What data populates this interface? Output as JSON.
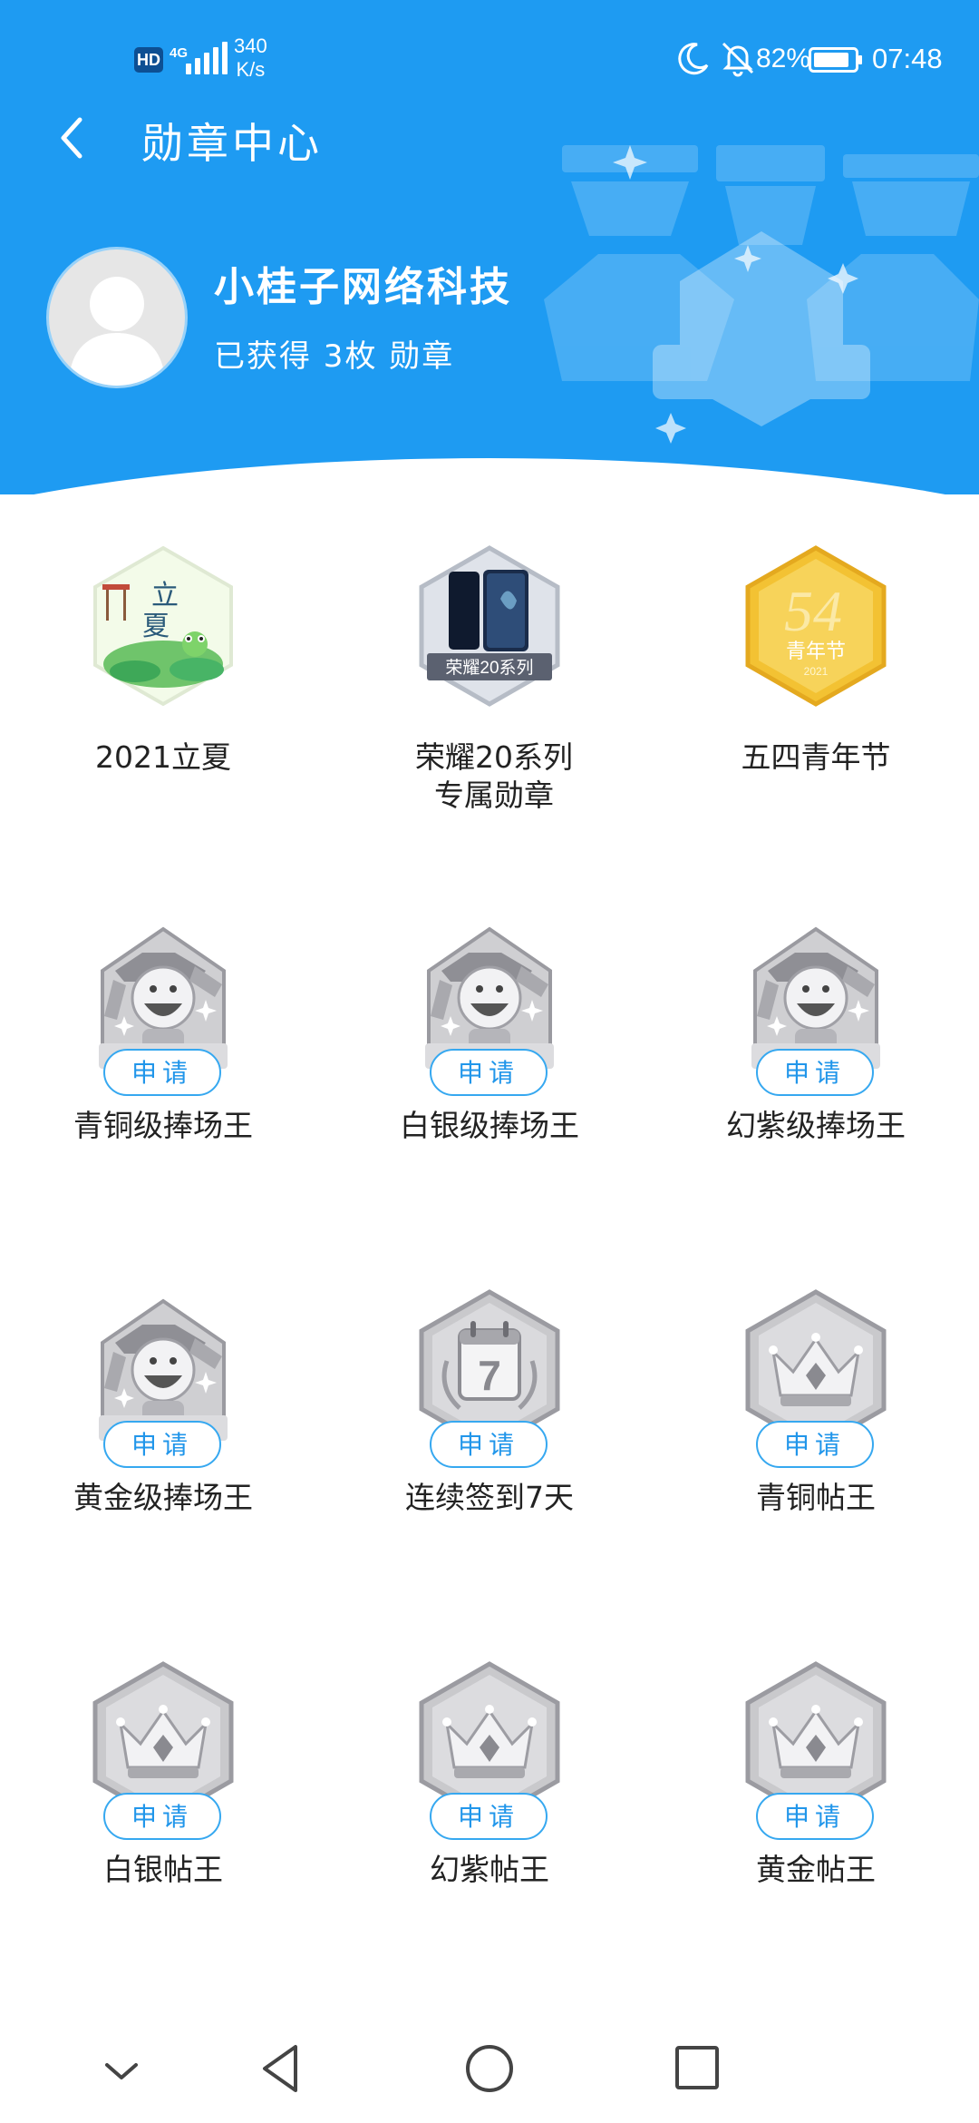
{
  "status_bar": {
    "hd": "HD",
    "network": "4G",
    "speed_value": "340",
    "speed_unit": "K/s",
    "battery": "82%",
    "time": "07:48"
  },
  "nav": {
    "title": "勋章中心"
  },
  "profile": {
    "name": "小桂子网络科技",
    "medal_count": "已获得 3枚 勋章"
  },
  "badges": [
    {
      "name": "2021立夏",
      "earned": true,
      "style": "summer"
    },
    {
      "name": "荣耀20系列专属勋章",
      "earned": true,
      "style": "phone",
      "caption": "荣耀20系列"
    },
    {
      "name": "五四青年节",
      "earned": true,
      "style": "youth",
      "caption": "青年节",
      "sub": "2021"
    },
    {
      "name": "青铜级捧场王",
      "earned": false,
      "style": "mascot",
      "caption": "捧场王",
      "action": "申请"
    },
    {
      "name": "白银级捧场王",
      "earned": false,
      "style": "mascot",
      "caption": "捧场王",
      "action": "申请"
    },
    {
      "name": "幻紫级捧场王",
      "earned": false,
      "style": "mascot",
      "caption": "捧场王",
      "action": "申请"
    },
    {
      "name": "黄金级捧场王",
      "earned": false,
      "style": "mascot",
      "caption": "捧场王",
      "action": "申请"
    },
    {
      "name": "连续签到7天",
      "earned": false,
      "style": "calendar",
      "caption": "7",
      "action": "申请"
    },
    {
      "name": "青铜帖王",
      "earned": false,
      "style": "crown",
      "action": "申请"
    },
    {
      "name": "白银帖王",
      "earned": false,
      "style": "crown",
      "action": "申请"
    },
    {
      "name": "幻紫帖王",
      "earned": false,
      "style": "crown",
      "action": "申请"
    },
    {
      "name": "黄金帖王",
      "earned": false,
      "style": "crown",
      "action": "申请"
    }
  ],
  "colors": {
    "header": "#1e9bf2",
    "accent": "#2196ea",
    "gold": "#f3c233"
  },
  "icons": {
    "back": "chevron-left-icon",
    "moon": "moon-icon",
    "mute": "bell-off-icon",
    "battery": "battery-icon",
    "nav_back": "triangle-back-icon",
    "nav_home": "circle-home-icon",
    "nav_recent": "square-recent-icon",
    "nav_hide": "chevron-down-icon"
  }
}
